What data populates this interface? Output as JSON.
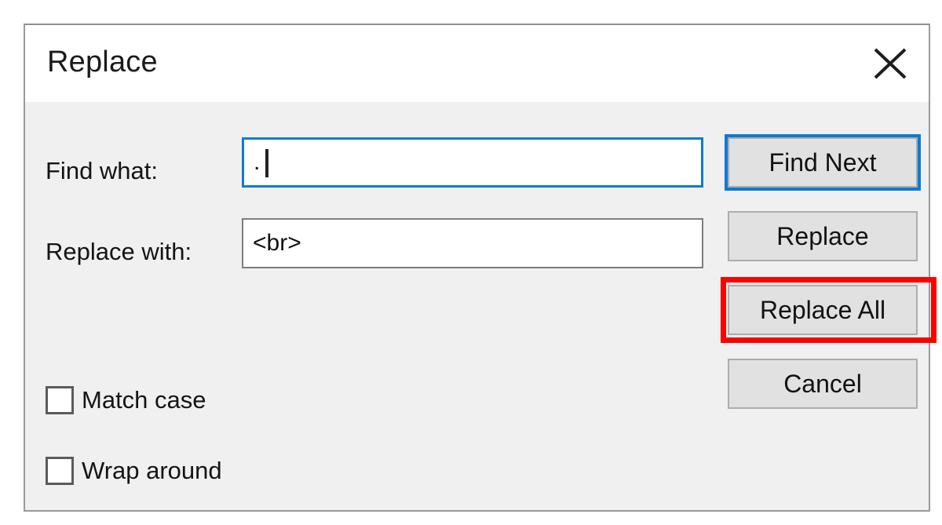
{
  "dialog": {
    "title": "Replace",
    "close_icon": "close-icon"
  },
  "fields": [
    {
      "label": "Find what:",
      "value": ".",
      "focused": true
    },
    {
      "label": "Replace with:",
      "value": "<br>",
      "focused": false
    }
  ],
  "buttons": [
    {
      "label": "Find Next",
      "default": true
    },
    {
      "label": "Replace",
      "default": false
    },
    {
      "label": "Replace All",
      "default": false,
      "highlighted": true
    },
    {
      "label": "Cancel",
      "default": false
    }
  ],
  "checkboxes": [
    {
      "label": "Match case",
      "checked": false
    },
    {
      "label": "Wrap around",
      "checked": false
    }
  ],
  "annotation": {
    "target": "Replace All",
    "color": "#ff0000"
  },
  "colors": {
    "dialog_body": "#f0f0f0",
    "titlebar": "#ffffff",
    "focus_blue": "#0c7ad4",
    "button_face": "#e1e1e1",
    "button_border": "#adadad",
    "annotation_red": "#ff0000",
    "text": "#141414"
  }
}
